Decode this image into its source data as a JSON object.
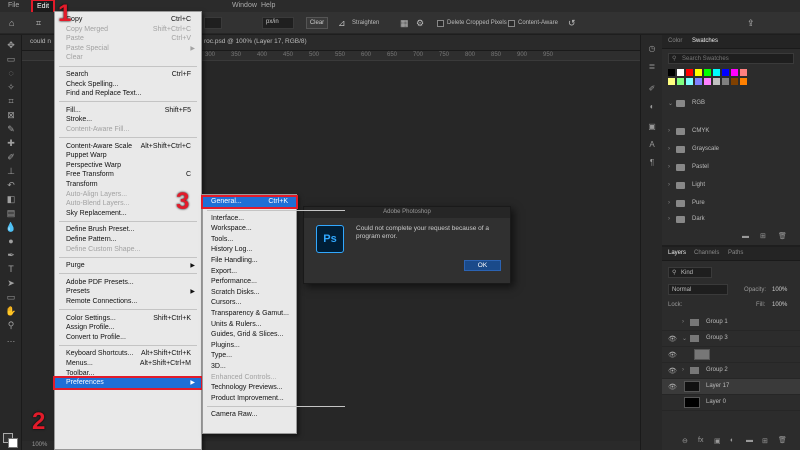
{
  "menubar": {
    "items": [
      "File",
      "Edit",
      "Window",
      "Help"
    ]
  },
  "optbar": {
    "unit": "px/in",
    "clear": "Clear",
    "straighten": "Straighten",
    "delete_cropped": "Delete Cropped Pixels",
    "content_aware": "Content-Aware"
  },
  "doc_tabs": [
    "could n",
    "roc.psd @ 100% (Layer 17, RGB/8)"
  ],
  "ruler_ticks": [
    "300",
    "350",
    "400",
    "450",
    "500",
    "550",
    "600",
    "650",
    "700",
    "750",
    "800",
    "850",
    "900",
    "950"
  ],
  "status": {
    "zoom": "100%"
  },
  "edit_menu": {
    "label": "Edit",
    "items": [
      {
        "label": "Copy",
        "shortcut": "Ctrl+C"
      },
      {
        "label": "Copy Merged",
        "shortcut": "Shift+Ctrl+C",
        "disabled": true
      },
      {
        "label": "Paste",
        "shortcut": "Ctrl+V",
        "disabled": true
      },
      {
        "label": "Paste Special",
        "arrow": true,
        "disabled": true
      },
      {
        "label": "Clear",
        "disabled": true
      },
      {
        "sep": true
      },
      {
        "label": "Search",
        "shortcut": "Ctrl+F"
      },
      {
        "label": "Check Spelling..."
      },
      {
        "label": "Find and Replace Text..."
      },
      {
        "sep": true
      },
      {
        "label": "Fill...",
        "shortcut": "Shift+F5"
      },
      {
        "label": "Stroke..."
      },
      {
        "label": "Content-Aware Fill...",
        "disabled": true
      },
      {
        "sep": true
      },
      {
        "label": "Content-Aware Scale",
        "shortcut": "Alt+Shift+Ctrl+C"
      },
      {
        "label": "Puppet Warp"
      },
      {
        "label": "Perspective Warp"
      },
      {
        "label": "Free Transform",
        "shortcut": "C"
      },
      {
        "label": "Transform"
      },
      {
        "label": "Auto-Align Layers...",
        "disabled": true
      },
      {
        "label": "Auto-Blend Layers...",
        "disabled": true
      },
      {
        "label": "Sky Replacement..."
      },
      {
        "sep": true
      },
      {
        "label": "Define Brush Preset..."
      },
      {
        "label": "Define Pattern..."
      },
      {
        "label": "Define Custom Shape...",
        "disabled": true
      },
      {
        "sep": true
      },
      {
        "label": "Purge",
        "arrow": true
      },
      {
        "sep": true
      },
      {
        "label": "Adobe PDF Presets..."
      },
      {
        "label": "Presets",
        "arrow": true
      },
      {
        "label": "Remote Connections..."
      },
      {
        "sep": true
      },
      {
        "label": "Color Settings...",
        "shortcut": "Shift+Ctrl+K"
      },
      {
        "label": "Assign Profile..."
      },
      {
        "label": "Convert to Profile..."
      },
      {
        "sep": true
      },
      {
        "label": "Keyboard Shortcuts...",
        "shortcut": "Alt+Shift+Ctrl+K"
      },
      {
        "label": "Menus...",
        "shortcut": "Alt+Shift+Ctrl+M"
      },
      {
        "label": "Toolbar..."
      },
      {
        "label": "Preferences",
        "arrow": true,
        "highlight": true
      }
    ]
  },
  "preferences_submenu": {
    "items": [
      {
        "label": "General...",
        "shortcut": "Ctrl+K",
        "highlight": true
      },
      {
        "sep": true
      },
      {
        "label": "Interface..."
      },
      {
        "label": "Workspace..."
      },
      {
        "label": "Tools..."
      },
      {
        "label": "History Log..."
      },
      {
        "label": "File Handling..."
      },
      {
        "label": "Export..."
      },
      {
        "label": "Performance..."
      },
      {
        "label": "Scratch Disks..."
      },
      {
        "label": "Cursors..."
      },
      {
        "label": "Transparency & Gamut..."
      },
      {
        "label": "Units & Rulers..."
      },
      {
        "label": "Guides, Grid & Slices..."
      },
      {
        "label": "Plugins..."
      },
      {
        "label": "Type..."
      },
      {
        "label": "3D..."
      },
      {
        "label": "Enhanced Controls...",
        "disabled": true
      },
      {
        "label": "Technology Previews..."
      },
      {
        "label": "Product Improvement..."
      },
      {
        "sep": true
      },
      {
        "label": "Camera Raw..."
      }
    ]
  },
  "dialog": {
    "title": "Adobe Photoshop",
    "logo": "Ps",
    "message": "Could not complete your request because of a program error.",
    "ok": "OK"
  },
  "swatches_panel": {
    "tabs": [
      "Color",
      "Swatches"
    ],
    "search_placeholder": "Search Swatches",
    "colors": [
      "#000000",
      "#ffffff",
      "#ff0000",
      "#ffff00",
      "#00ff00",
      "#00ffff",
      "#0000ff",
      "#ff00ff",
      "#ff8080",
      "#ffff80",
      "#80ff80",
      "#80ffff",
      "#8080ff",
      "#ff80ff",
      "#c0c0c0",
      "#808080",
      "#804000",
      "#ff8000"
    ],
    "groups": [
      "RGB",
      "CMYK",
      "Grayscale",
      "Pastel",
      "Light",
      "Pure",
      "Dark"
    ]
  },
  "layers_panel": {
    "tabs": [
      "Layers",
      "Channels",
      "Paths"
    ],
    "kind": "Kind",
    "blend": "Normal",
    "opacity_label": "Opacity:",
    "opacity": "100%",
    "lock_label": "Lock:",
    "fill_label": "Fill:",
    "fill": "100%",
    "layers": [
      {
        "name": "Group 1",
        "type": "group"
      },
      {
        "name": "Group 3",
        "type": "group"
      },
      {
        "name": "",
        "type": "layer"
      },
      {
        "name": "Group 2",
        "type": "group"
      },
      {
        "name": "Layer 17",
        "type": "layer"
      },
      {
        "name": "Layer 0",
        "type": "layer"
      }
    ]
  },
  "steps": [
    "1",
    "2",
    "3"
  ],
  "colors": {
    "accent_red": "#e21b2a",
    "highlight_blue": "#1f6fd6"
  }
}
